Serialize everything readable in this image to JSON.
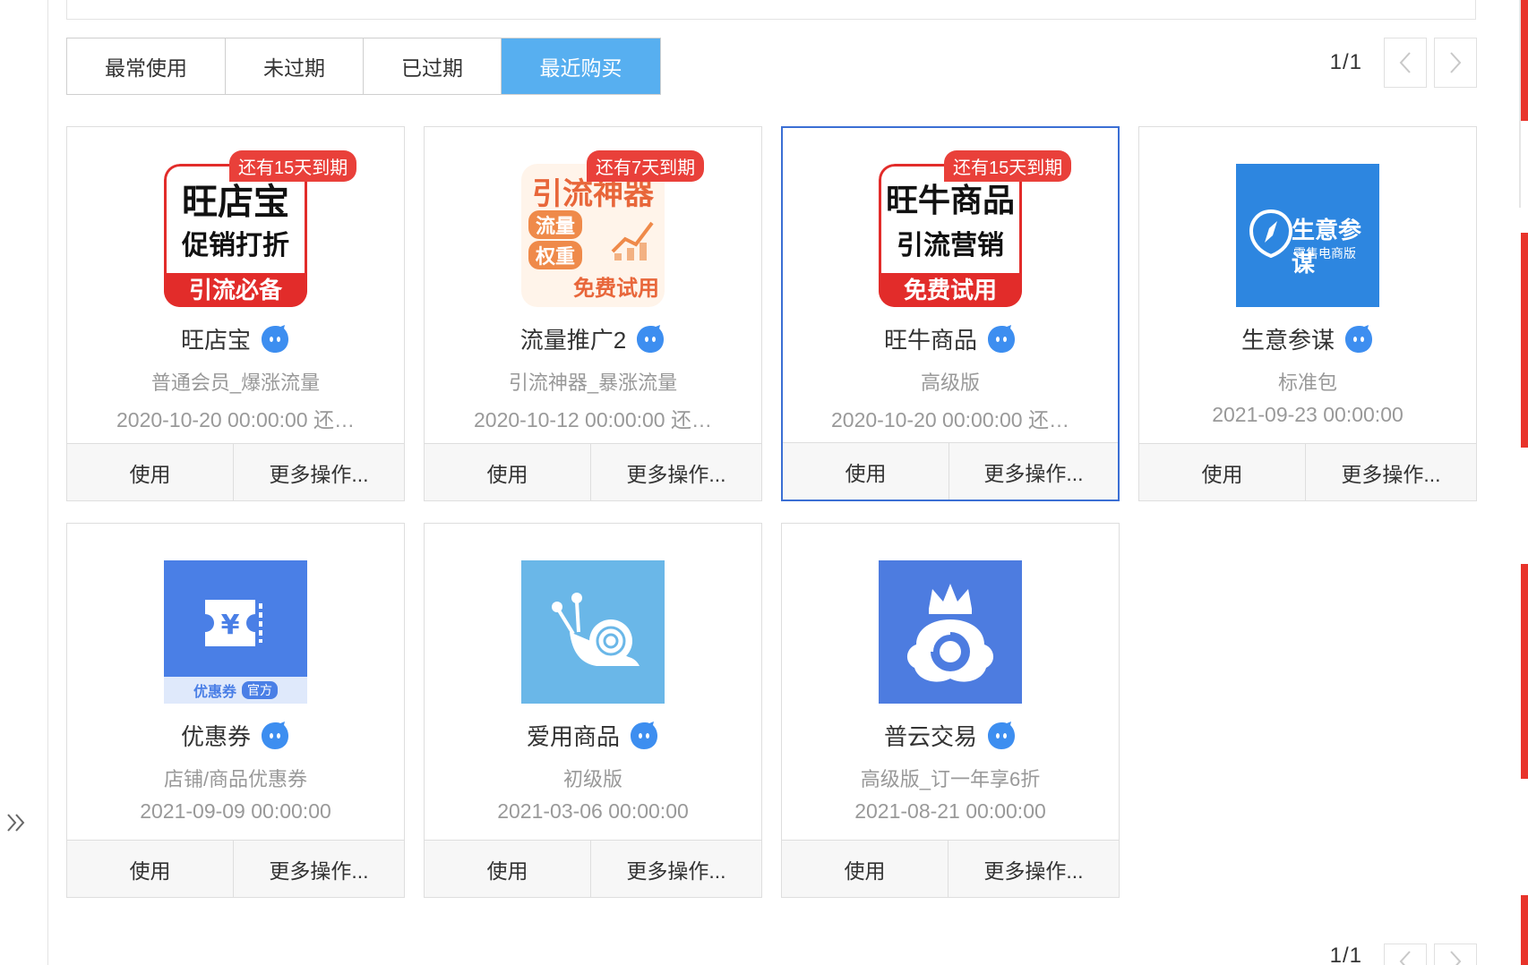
{
  "tabs": [
    {
      "label": "最常使用",
      "active": false
    },
    {
      "label": "未过期",
      "active": false
    },
    {
      "label": "已过期",
      "active": false
    },
    {
      "label": "最近购买",
      "active": true
    }
  ],
  "pager": {
    "text": "1/1"
  },
  "actions": {
    "use": "使用",
    "more": "更多操作..."
  },
  "cards": [
    {
      "name": "旺店宝",
      "sub": "普通会员_爆涨流量",
      "date": "2020-10-20 00:00:00 还…",
      "badge": "还有15天到期",
      "thumb": {
        "line1": "旺店宝",
        "line2": "促销打折",
        "foot": "引流必备"
      }
    },
    {
      "name": "流量推广2",
      "sub": "引流神器_暴涨流量",
      "date": "2020-10-12 00:00:00 还…",
      "badge": "还有7天到期",
      "thumb": {
        "line1": "引流神器",
        "tag1": "流量",
        "tag2": "权重",
        "foot": "免费试用"
      }
    },
    {
      "name": "旺牛商品",
      "sub": "高级版",
      "date": "2020-10-20 00:00:00 还…",
      "badge": "还有15天到期",
      "thumb": {
        "line1": "旺牛商品",
        "line2": "引流营销",
        "foot": "免费试用"
      }
    },
    {
      "name": "生意参谋",
      "sub": "标准包",
      "date": "2021-09-23 00:00:00",
      "badge": "",
      "thumb": {
        "line1": "生意参谋",
        "line2": "零售电商版"
      }
    },
    {
      "name": "优惠券",
      "sub": "店铺/商品优惠券",
      "date": "2021-09-09 00:00:00",
      "badge": "",
      "thumb": {
        "line1": "优惠券",
        "line2": "官方"
      }
    },
    {
      "name": "爱用商品",
      "sub": "初级版",
      "date": "2021-03-06 00:00:00",
      "badge": ""
    },
    {
      "name": "普云交易",
      "sub": "高级版_订一年享6折",
      "date": "2021-08-21 00:00:00",
      "badge": ""
    }
  ],
  "colors": {
    "active_tab": "#57aff0",
    "badge": "#e9403a",
    "selected_border": "#3b6fd4",
    "brand_red": "#e22c2a"
  }
}
